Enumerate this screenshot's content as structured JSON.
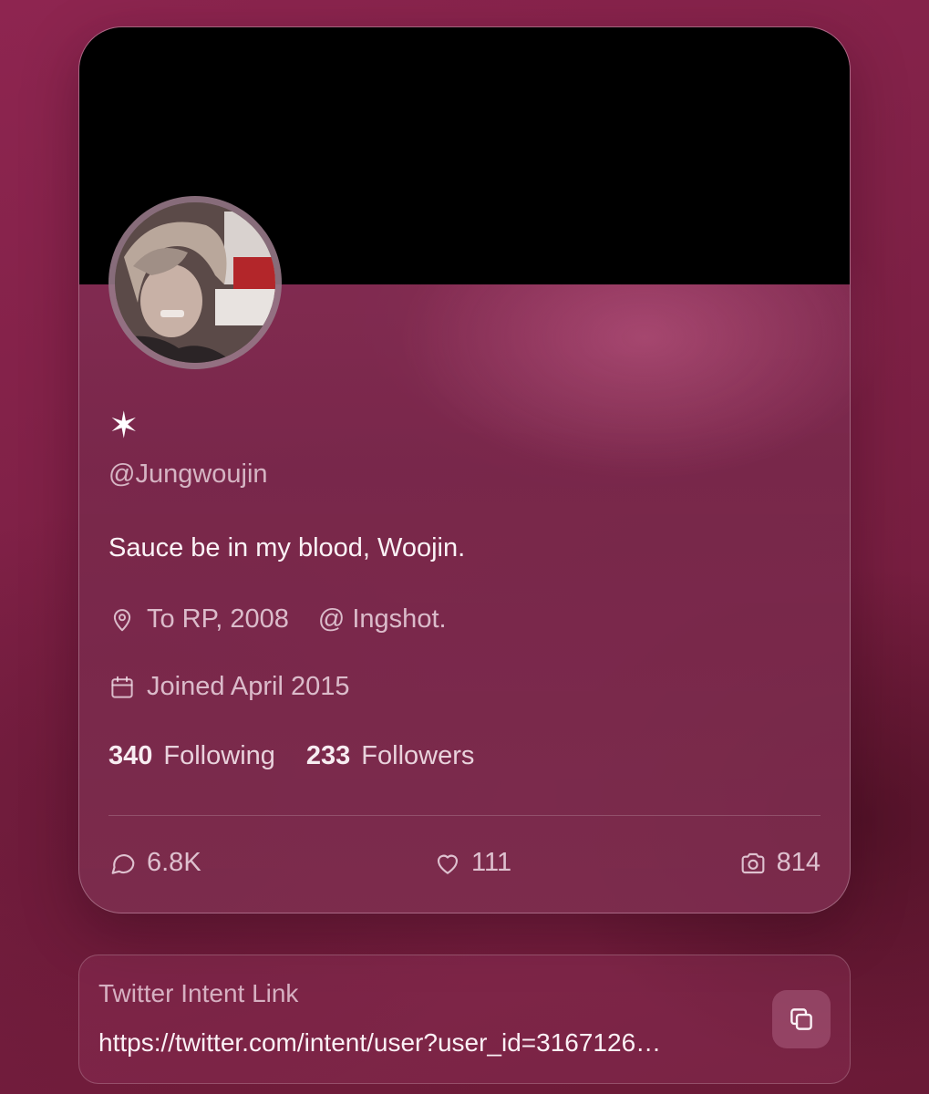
{
  "profile": {
    "display_name": "✶",
    "handle": "@Jungwoujin",
    "bio": "Sauce be in my blood, Woojin.",
    "location": "To RP, 2008",
    "website": "@ Ingshot.",
    "joined": "Joined April 2015",
    "following_count": "340",
    "following_label": "Following",
    "followers_count": "233",
    "followers_label": "Followers"
  },
  "stats": {
    "comments": "6.8K",
    "likes": "111",
    "media": "814"
  },
  "intent": {
    "label": "Twitter Intent Link",
    "url": "https://twitter.com/intent/user?user_id=3167126…"
  },
  "icons": {
    "location": "map-pin-icon",
    "calendar": "calendar-icon",
    "comment": "speech-bubble-icon",
    "like": "heart-icon",
    "media": "camera-icon",
    "copy": "copy-icon"
  },
  "colors": {
    "background": "#7d2045",
    "banner": "#000000",
    "text": "#f3e6ec"
  }
}
